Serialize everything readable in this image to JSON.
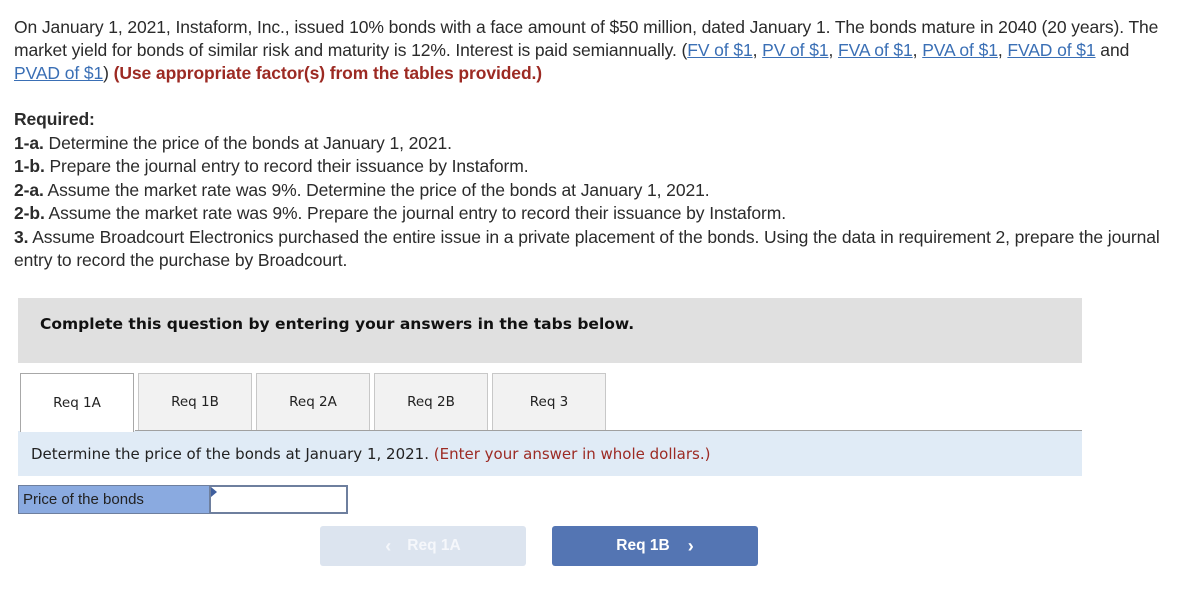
{
  "question": {
    "intro_1": "On January 1, 2021, Instaform, Inc., issued 10% bonds with a face amount of $50 million, dated January 1. The bonds mature in 2040 (20 years). The market yield for bonds of similar risk and maturity is 12%. Interest is paid semiannually. (",
    "links": [
      "FV of $1",
      "PV of $1",
      "FVA of $1",
      "PVA of $1",
      "FVAD of $1",
      "PVAD of $1"
    ],
    "sep_comma": ", ",
    "sep_and": " and ",
    "close_paren": ") ",
    "emphasis": "(Use appropriate factor(s) from the tables provided.)"
  },
  "required": {
    "heading": "Required:",
    "items": [
      {
        "label": "1-a.",
        "text": " Determine the price of the bonds at January 1, 2021."
      },
      {
        "label": "1-b.",
        "text": " Prepare the journal entry to record their issuance by Instaform."
      },
      {
        "label": "2-a.",
        "text": " Assume the market rate was 9%. Determine the price of the bonds at January 1, 2021."
      },
      {
        "label": "2-b.",
        "text": " Assume the market rate was 9%. Prepare the journal entry to record their issuance by Instaform."
      },
      {
        "label": "3.",
        "text": " Assume Broadcourt Electronics purchased the entire issue in a private placement of the bonds. Using the data in requirement 2, prepare the journal entry to record the purchase by Broadcourt."
      }
    ]
  },
  "instruction": "Complete this question by entering your answers in the tabs below.",
  "tabs": [
    {
      "label": "Req 1A",
      "active": true
    },
    {
      "label": "Req 1B",
      "active": false
    },
    {
      "label": "Req 2A",
      "active": false
    },
    {
      "label": "Req 2B",
      "active": false
    },
    {
      "label": "Req 3",
      "active": false
    }
  ],
  "prompt": {
    "main": "Determine the price of the bonds at January 1, 2021.",
    "hint": "(Enter your answer in whole dollars.)"
  },
  "answer": {
    "label": "Price of the bonds",
    "value": ""
  },
  "nav": {
    "prev_label": "Req 1A",
    "next_label": "Req 1B",
    "prev_icon": "‹",
    "next_icon": "›"
  },
  "colors": {
    "link": "#3a6fb5",
    "emphasis": "#9c2a23",
    "next_button": "#5475b3",
    "prev_button_disabled": "#dce4ef",
    "label_cell": "#8aaae0",
    "prompt_bg": "#e0ebf6",
    "instruction_bg": "#e0e0e0"
  }
}
